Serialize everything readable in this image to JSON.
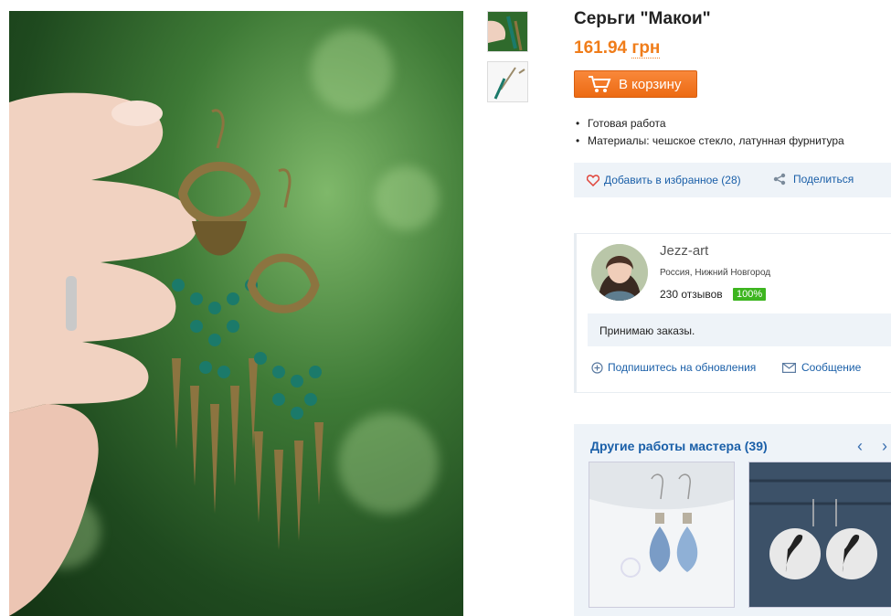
{
  "product": {
    "title": "Серьги \"Макои\"",
    "price_value": "161.94",
    "price_currency": "грн",
    "cart_label": "В корзину",
    "properties": [
      "Готовая работа",
      "Материалы: чешское стекло, латунная фурнитура"
    ]
  },
  "actions": {
    "favorite_label": "Добавить в избранное (28)",
    "share_label": "Поделиться"
  },
  "seller": {
    "name": "Jezz-art",
    "location": "Россия, Нижний Новгород",
    "reviews": "230 отзывов",
    "rating": "100%",
    "message": "Принимаю заказы.",
    "subscribe_label": "Подпишитесь на обновления",
    "contact_label": "Сообщение"
  },
  "other_works": {
    "title": "Другие работы мастера (39)",
    "prev": "‹",
    "next": "›"
  },
  "colors": {
    "accent_orange": "#f07d1a",
    "link_blue": "#1a5fa8",
    "badge_green": "#3db51f"
  },
  "icons": [
    "cart-icon",
    "heart-icon",
    "share-icon",
    "plus-circle-icon",
    "envelope-icon",
    "chevron-left-icon",
    "chevron-right-icon"
  ]
}
